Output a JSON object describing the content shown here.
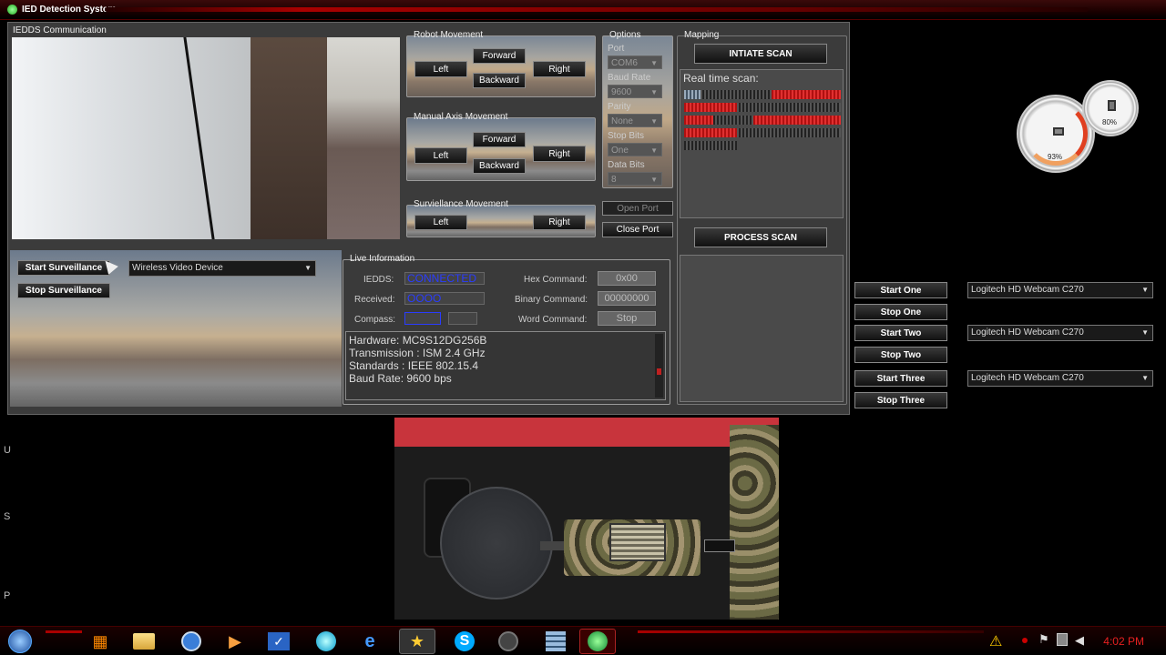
{
  "window": {
    "title": "IED Detection System"
  },
  "communication": {
    "title": "IEDDS Communication"
  },
  "robot_movement": {
    "title": "Robot Movement",
    "left": "Left",
    "forward": "Forward",
    "backward": "Backward",
    "right": "Right"
  },
  "manual_axis": {
    "title": "Manual Axis Movement",
    "left": "Left",
    "forward": "Forward",
    "backward": "Backward",
    "right": "Right"
  },
  "surveillance_movement": {
    "title": "Surviellance Movement",
    "left": "Left",
    "right": "Right"
  },
  "options": {
    "title": "Options",
    "port_label": "Port",
    "port_value": "COM6",
    "baud_label": "Baud Rate",
    "baud_value": "9600",
    "parity_label": "Parity",
    "parity_value": "None",
    "stopbits_label": "Stop Bits",
    "stopbits_value": "One",
    "databits_label": "Data Bits",
    "databits_value": "8",
    "open_port": "Open Port",
    "close_port": "Close Port"
  },
  "mapping": {
    "title": "Mapping",
    "initiate": "INTIATE SCAN",
    "realtime": "Real time scan:",
    "process": "PROCESS SCAN"
  },
  "surveillance": {
    "start": "Start Surveillance",
    "stop": "Stop Surveillance",
    "device": "Wireless Video Device"
  },
  "live": {
    "title": "Live Information",
    "iedds_label": "IEDDS:",
    "iedds_value": "CONNECTED",
    "received_label": "Received:",
    "received_value": "OOOO",
    "compass_label": "Compass:",
    "hex_label": "Hex Command:",
    "hex_value": "0x00",
    "binary_label": "Binary Command:",
    "binary_value": "00000000",
    "word_label": "Word Command:",
    "word_value": "Stop",
    "hw_lines": [
      "Hardware: MC9S12DG256B",
      "Transmission : ISM 2.4 GHz",
      "Standards : IEEE 802.15.4",
      "Baud Rate: 9600 bps"
    ]
  },
  "cameras": [
    {
      "start": "Start One",
      "stop": "Stop One",
      "device": "Logitech HD Webcam C270"
    },
    {
      "start": "Start Two",
      "stop": "Stop Two",
      "device": "Logitech HD Webcam C270"
    },
    {
      "start": "Start Three",
      "stop": "Stop Three",
      "device": "Logitech HD Webcam C270"
    }
  ],
  "gauges": {
    "cpu": "93%",
    "mem": "80%"
  },
  "desktop_edge": [
    "U",
    "S",
    "P"
  ],
  "taskbar": {
    "clock": "4:02 PM"
  },
  "colors": {
    "accent_red": "#e03030",
    "connected_blue": "#2a3cff"
  }
}
